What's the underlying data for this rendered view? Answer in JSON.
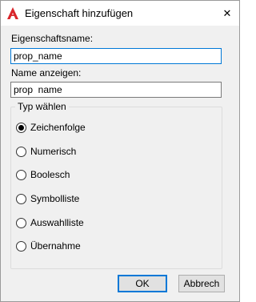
{
  "window": {
    "title": "Eigenschaft hinzufügen",
    "close_glyph": "✕"
  },
  "fields": {
    "property_name": {
      "label": "Eigenschaftsname:",
      "value": "prop_name"
    },
    "display_name": {
      "label": "Name anzeigen:",
      "value": "prop  name"
    }
  },
  "type_group": {
    "legend": "Typ wählen",
    "selected": "Zeichenfolge",
    "options": [
      {
        "label": "Zeichenfolge",
        "checked": true
      },
      {
        "label": "Numerisch",
        "checked": false
      },
      {
        "label": "Boolesch",
        "checked": false
      },
      {
        "label": "Symbolliste",
        "checked": false
      },
      {
        "label": "Auswahlliste",
        "checked": false
      },
      {
        "label": "Übernahme",
        "checked": false
      }
    ]
  },
  "buttons": {
    "ok_label": "OK",
    "cancel_label": "Abbrech"
  },
  "colors": {
    "app_icon": "#d9262b",
    "focus_border": "#0078d7",
    "dialog_bg": "#f0f0f0"
  }
}
